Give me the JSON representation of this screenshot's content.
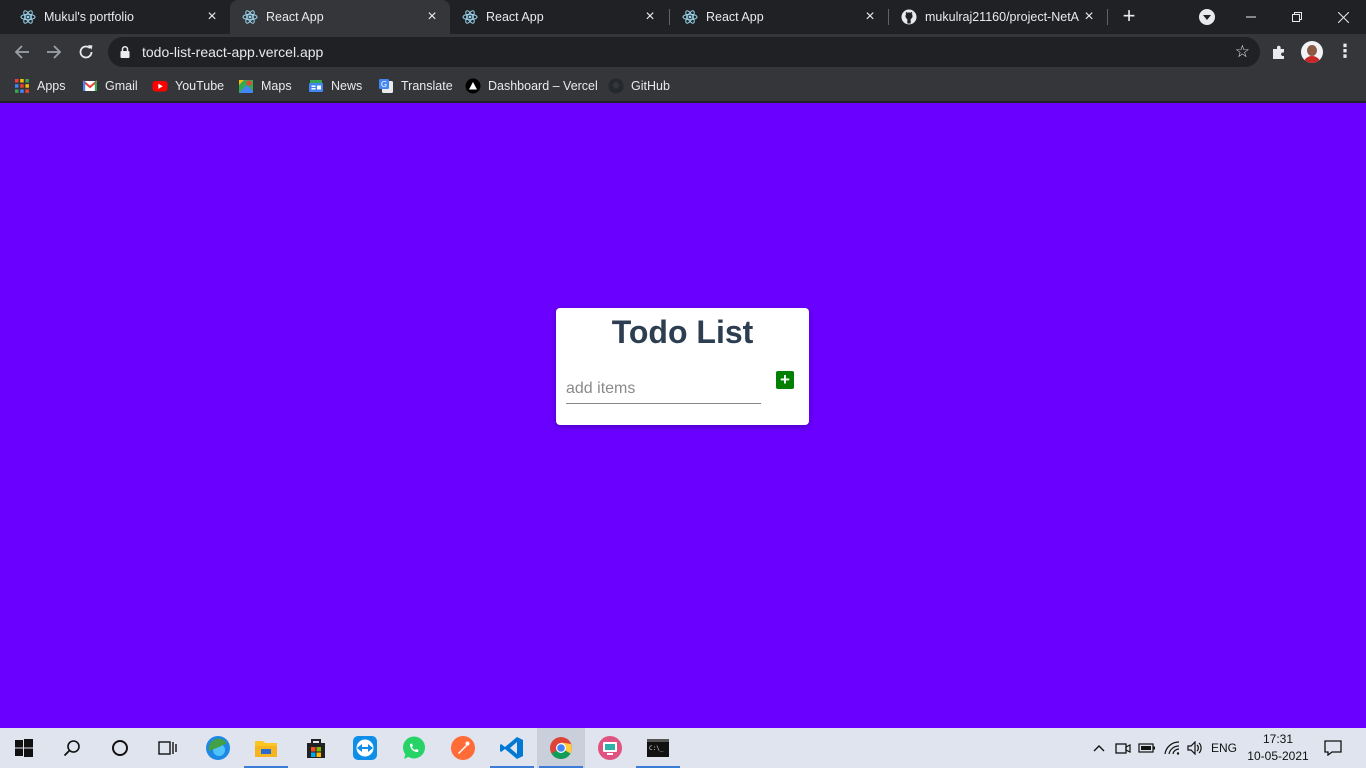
{
  "browser": {
    "tabs": [
      {
        "title": "Mukul's portfolio",
        "icon": "react-icon",
        "active": false
      },
      {
        "title": "React App",
        "icon": "react-icon",
        "active": true
      },
      {
        "title": "React App",
        "icon": "react-icon",
        "active": false
      },
      {
        "title": "React App",
        "icon": "react-icon",
        "active": false
      },
      {
        "title": "mukulraj21160/project-NetA",
        "icon": "github-icon",
        "active": false
      }
    ],
    "url": "todo-list-react-app.vercel.app",
    "bookmarks": [
      {
        "label": "Apps",
        "icon": "apps-grid-icon"
      },
      {
        "label": "Gmail",
        "icon": "gmail-icon"
      },
      {
        "label": "YouTube",
        "icon": "youtube-icon"
      },
      {
        "label": "Maps",
        "icon": "maps-icon"
      },
      {
        "label": "News",
        "icon": "news-icon"
      },
      {
        "label": "Translate",
        "icon": "translate-icon"
      },
      {
        "label": "Dashboard – Vercel",
        "icon": "vercel-icon"
      },
      {
        "label": "GitHub",
        "icon": "github-icon"
      }
    ]
  },
  "page": {
    "background": "#6a00ff",
    "card": {
      "title": "Todo List",
      "input_placeholder": "add items",
      "input_value": "",
      "add_button_label": "+",
      "add_button_color": "#008000"
    }
  },
  "taskbar": {
    "apps": [
      "start-icon",
      "search-icon",
      "cortana-icon",
      "task-view-icon",
      "edge-icon",
      "file-explorer-icon",
      "store-icon",
      "teamviewer-icon",
      "whatsapp-icon",
      "postman-icon",
      "vscode-icon",
      "chrome-icon",
      "screen-app-icon",
      "terminal-icon"
    ],
    "tray": {
      "language": "ENG",
      "time": "17:31",
      "date": "10-05-2021"
    }
  }
}
